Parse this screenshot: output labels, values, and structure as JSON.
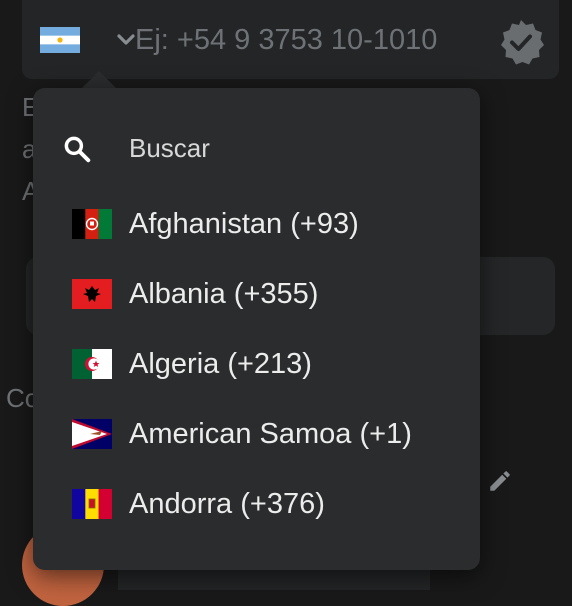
{
  "phone_field": {
    "placeholder": "Ej: +54 9 3753 10-1010",
    "selected_country_flag": "argentina-flag"
  },
  "background": {
    "line1_fragment": "E",
    "line2_fragment": "a",
    "line3_fragment": "A",
    "section_label_fragment": "Co"
  },
  "dropdown": {
    "search_placeholder": "Buscar",
    "countries": [
      {
        "label": "Afghanistan (+93)",
        "flag": "afghanistan-flag"
      },
      {
        "label": "Albania (+355)",
        "flag": "albania-flag"
      },
      {
        "label": "Algeria (+213)",
        "flag": "algeria-flag"
      },
      {
        "label": "American Samoa (+1)",
        "flag": "american-samoa-flag"
      },
      {
        "label": "Andorra (+376)",
        "flag": "andorra-flag"
      }
    ]
  },
  "colors": {
    "background": "#191919",
    "surface": "#232526",
    "dropdown": "#2a2c2d",
    "placeholder": "#6e7276",
    "avatar": "#c0633f"
  }
}
